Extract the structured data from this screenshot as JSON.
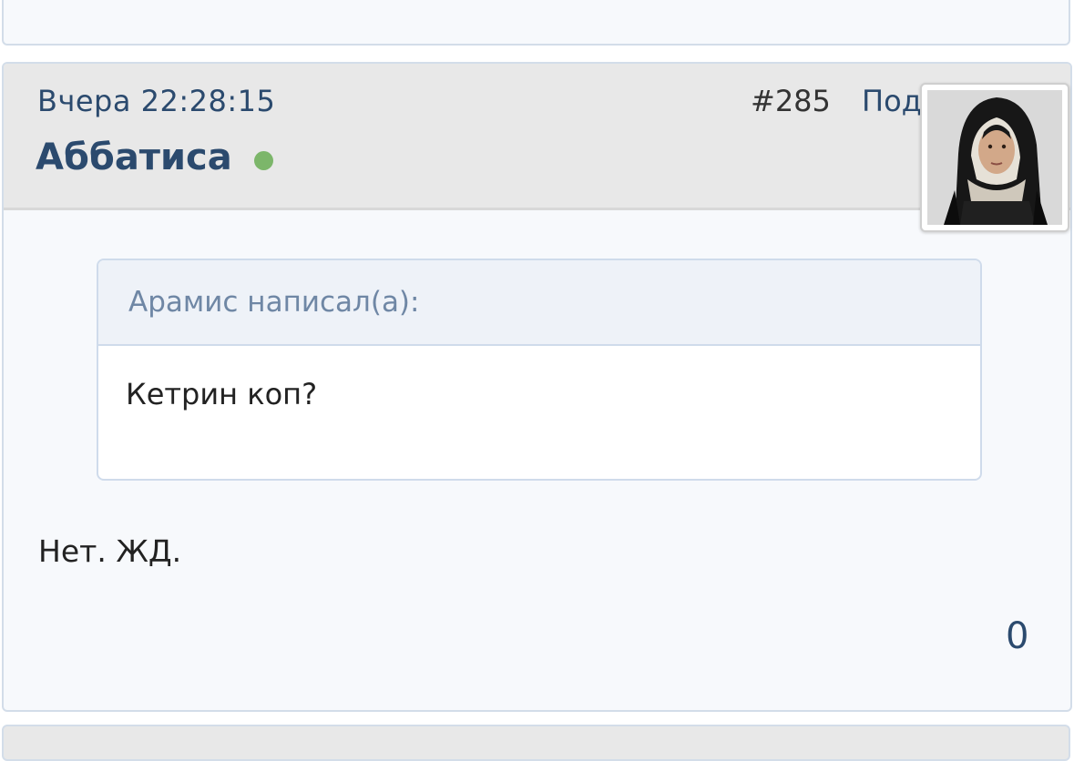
{
  "post": {
    "date": "Вчера 22:28:15",
    "number": "#285",
    "subscribe_label": "Подписаться",
    "author": "Аббатиса",
    "author_online": true,
    "online_color": "#7cb66a",
    "avatar_icon": "user-avatar-nun",
    "quote": {
      "author_line": "Арамис написал(а):",
      "text": "Кетрин коп?"
    },
    "text": "Нет. ЖД.",
    "reaction_count": "0"
  },
  "colors": {
    "accent": "#2b4a6e",
    "card_bg": "#f7f9fc",
    "header_bg": "#e8e8e8",
    "quote_header_bg": "#eef2f8",
    "quote_author_color": "#6f87a5",
    "border": "#d3dde9"
  }
}
